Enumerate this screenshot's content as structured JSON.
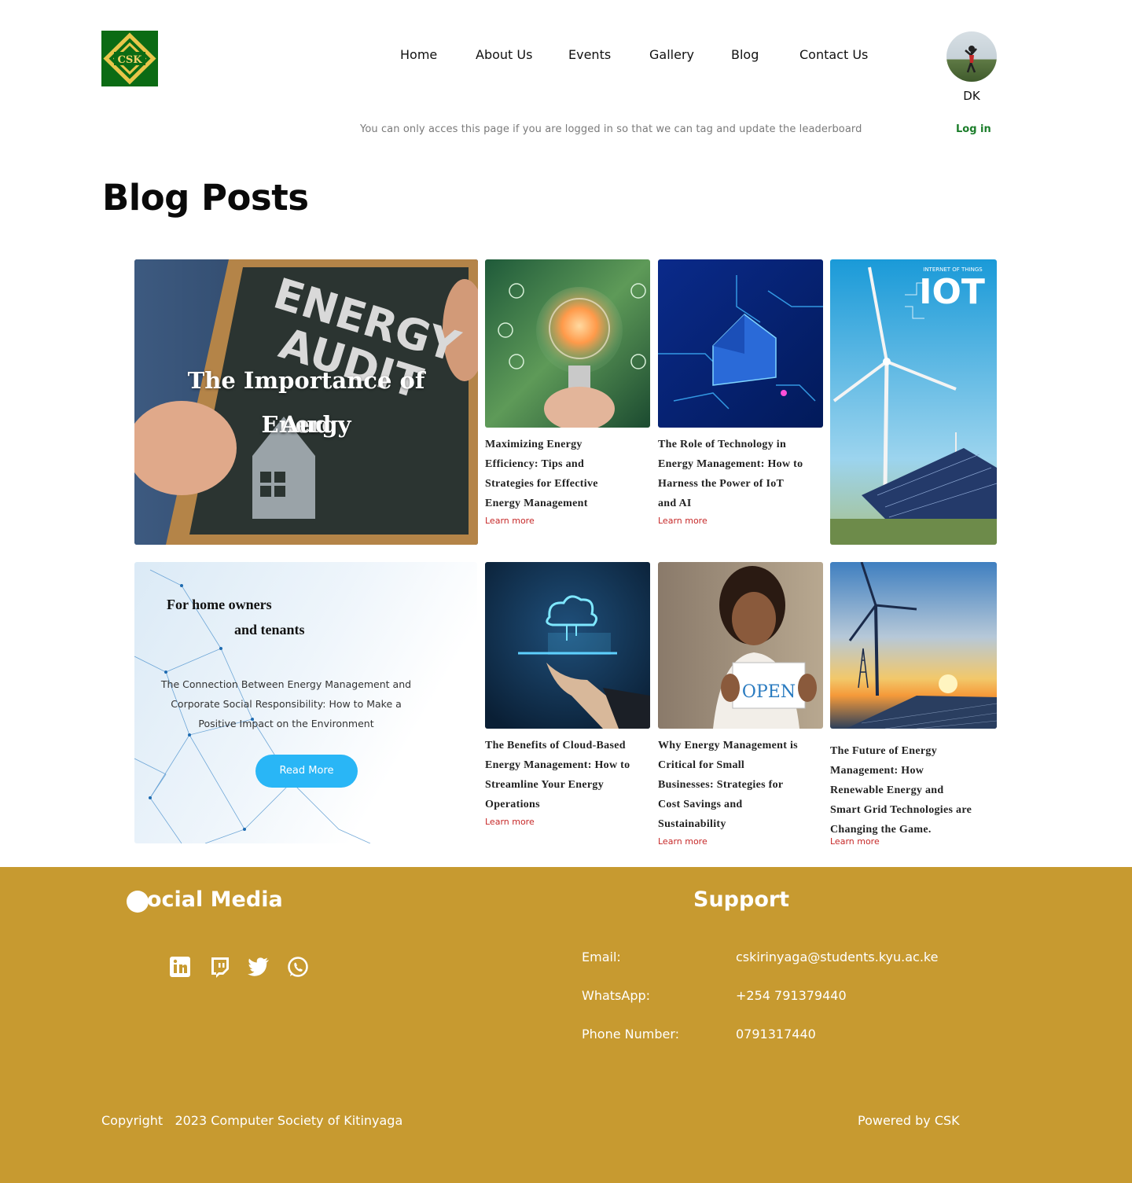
{
  "header": {
    "logo_text": "CSK",
    "nav": [
      {
        "label": "Home"
      },
      {
        "label": "About Us"
      },
      {
        "label": "Events"
      },
      {
        "label": "Gallery"
      },
      {
        "label": "Blog"
      },
      {
        "label": "Contact Us"
      }
    ],
    "user_initials": "DK",
    "notice": "You can only acces this page if you are logged in so that we can tag and update the leaderboard",
    "login_label": "Log in"
  },
  "page_title": "Blog Posts",
  "featured": {
    "image_text_line1": "ENERGY",
    "image_text_line2": "AUDIT",
    "title_line1": "The Importance of Energy",
    "title_line2": "Aud"
  },
  "posts": [
    {
      "title_lines": [
        "Maximizing Energy",
        "Efficiency: Tips and",
        "Strategies for Effective",
        "Energy Management"
      ],
      "link": "Learn more"
    },
    {
      "title_lines": [
        "The Role of Technology in",
        "Energy Management: How to",
        "Harness the Power of IoT",
        "and AI"
      ],
      "link": "Learn more"
    },
    {
      "title_lines": [
        "The Benefits of Cloud-Based",
        "Energy Management: How to",
        "Streamline Your Energy",
        "Operations"
      ],
      "link": "Learn more"
    },
    {
      "title_lines": [
        "Why Energy Management is",
        "Critical for Small",
        "Businesses: Strategies for",
        "Cost Savings and",
        "Sustainability"
      ],
      "link": "Learn more"
    },
    {
      "title_lines": [
        "The Future of Energy",
        "Management: How",
        "Renewable Energy and",
        "Smart Grid Technologies are",
        "Changing the Game."
      ],
      "link": "Learn more"
    }
  ],
  "iot_image": {
    "caption_small": "INTERNET OF THINGS",
    "caption_big": "IOT"
  },
  "open_sign": "OPEN",
  "promo": {
    "heading_line1": "For home owners",
    "heading_line2": "and tenants",
    "text_lines": [
      "The Connection Between Energy Management and",
      "Corporate Social Responsibility: How to Make a",
      "Positive Impact on the Environment"
    ],
    "button": "Read More"
  },
  "footer": {
    "social_title": "ocial Media",
    "support_title": "Support",
    "social_icons": [
      "linkedin-icon",
      "twitch-icon",
      "twitter-icon",
      "whatsapp-icon"
    ],
    "support": [
      {
        "label": "Email:",
        "value": "cskirinyaga@students.kyu.ac.ke"
      },
      {
        "label": "WhatsApp:",
        "value": "+254 791379440"
      },
      {
        "label": "Phone Number:",
        "value": "0791317440"
      }
    ],
    "copyright": "Copyright   2023 Computer Society of Kitinyaga",
    "powered": "Powered by CSK"
  },
  "colors": {
    "footer_bg": "#c79a30",
    "logo_green": "#0b6b14",
    "login_green": "#1b7d2a",
    "link_red": "#c62828",
    "button_blue": "#29b6f6"
  }
}
